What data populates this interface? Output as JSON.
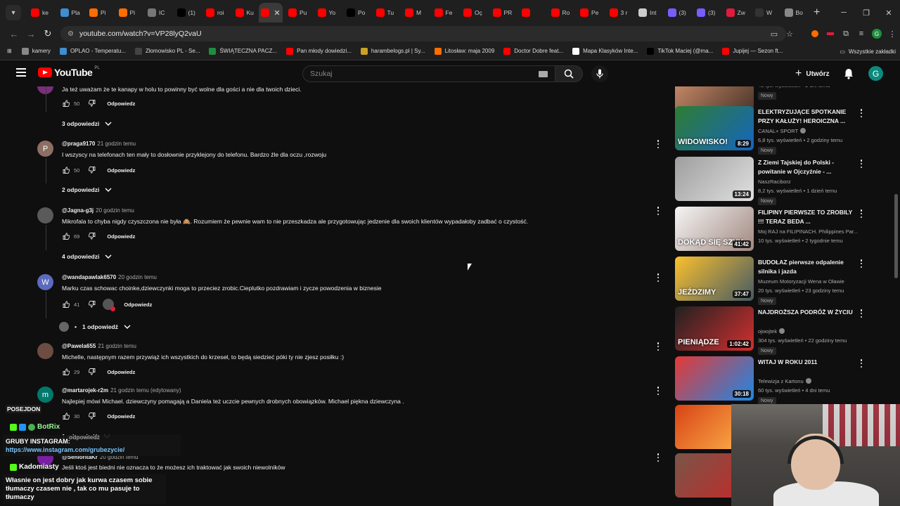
{
  "browser": {
    "tabs": [
      {
        "t": "ke",
        "c": "#ff0000"
      },
      {
        "t": "Pla",
        "c": "#3e8ed0"
      },
      {
        "t": "Pi",
        "c": "#ff6d00"
      },
      {
        "t": "Pi",
        "c": "#ff6d00"
      },
      {
        "t": "IC",
        "c": "#777777"
      },
      {
        "t": "(1)",
        "c": "#000000"
      },
      {
        "t": "roi",
        "c": "#ff0000"
      },
      {
        "t": "Ku",
        "c": "#ff0000"
      },
      {
        "t": "",
        "c": "#ff0000",
        "active": true
      },
      {
        "t": "Pu",
        "c": "#ff0000"
      },
      {
        "t": "Yo",
        "c": "#ff0000"
      },
      {
        "t": "Po",
        "c": "#000000"
      },
      {
        "t": "Tu",
        "c": "#ff0000"
      },
      {
        "t": "M",
        "c": "#ff0000"
      },
      {
        "t": "Fe",
        "c": "#ff0000"
      },
      {
        "t": "Oç",
        "c": "#ff0000"
      },
      {
        "t": "PR",
        "c": "#ff0000"
      },
      {
        "t": "",
        "c": "#ff0000"
      },
      {
        "t": "Ro",
        "c": "#ff0000"
      },
      {
        "t": "Pe",
        "c": "#ff0000"
      },
      {
        "t": "3 r",
        "c": "#ff0000"
      },
      {
        "t": "Int",
        "c": "#cccccc"
      },
      {
        "t": "(3)",
        "c": "#7b5cff"
      },
      {
        "t": "(3)",
        "c": "#7b5cff"
      },
      {
        "t": "Zw",
        "c": "#e21b3c"
      },
      {
        "t": "W",
        "c": "#333333"
      },
      {
        "t": "Bo",
        "c": "#888888"
      }
    ],
    "url": "youtube.com/watch?v=VP28lyQ2vaU",
    "bookmarks": [
      {
        "label": "kamery",
        "c": "#888888"
      },
      {
        "label": "OPLAO - Temperatu...",
        "c": "#3e8ed0"
      },
      {
        "label": "Złomowisko PL - Se...",
        "c": "#444444"
      },
      {
        "label": "ŚWIĄTECZNA PACZ...",
        "c": "#1e8e3e"
      },
      {
        "label": "Pan młody dowiedzi...",
        "c": "#ff0000"
      },
      {
        "label": "harambelogs.pl | Sy...",
        "c": "#c9a227"
      },
      {
        "label": "Litosław: maja 2009",
        "c": "#ff6d00"
      },
      {
        "label": "Doctor Dobre feat...",
        "c": "#ff0000"
      },
      {
        "label": "Mapa Klasyków Inte...",
        "c": "#ffffff"
      },
      {
        "label": "TikTok Maciej (@ma...",
        "c": "#000000"
      },
      {
        "label": "Jupijej — Sezon ft...",
        "c": "#ff0000"
      }
    ],
    "bookmarks_right": "Wszystkie zakładki"
  },
  "youtube": {
    "logo": "YouTube",
    "country": "PL",
    "search_placeholder": "Szukaj",
    "create_label": "Utwórz",
    "avatar_letter": "G"
  },
  "comments": [
    {
      "type": "partial",
      "text": "Ja też uważam że te kanapy w holu to powinny być wolne dla  gości  a nie dla twoich dzieci.",
      "likes": "50",
      "reply": "Odpowiedz",
      "replies": "3 odpowiedzi",
      "av_c": "#7a2f7a"
    },
    {
      "author": "@praga9170",
      "time": "21 godzin temu",
      "text": "I  wszyscy  na  telefonach  ten  mały  to  dosłownie  przyklejony do  telefonu. Bardzo  źle  dla  oczu  ,rozwoju",
      "likes": "50",
      "reply": "Odpowiedz",
      "replies": "2 odpowiedzi",
      "letter": "P",
      "av_c": "#8d6e63"
    },
    {
      "author": "@Jagna-g3j",
      "time": "20 godzin temu",
      "text": "Mikrofala to chyba nigdy czyszczona nie była 🙈. Rozumiem że pewnie wam to nie przeszkadza ale przygotowując jedzenie dla swoich klientów wypadałoby zadbać o czystość.",
      "likes": "69",
      "reply": "Odpowiedz",
      "replies": "4 odpowiedzi",
      "letter": "",
      "av_c": "#5a5a5a"
    },
    {
      "author": "@wandapawlak6570",
      "time": "20 godzin temu",
      "text": "Marku czas schowac choinke,dziewczynki moga to przeciez zrobic.Cieplutko pozdrawiam i zycze powodzenia w biznesie",
      "likes": "41",
      "reply": "Odpowiedz",
      "replies": "1 odpowiedź",
      "letter": "W",
      "av_c": "#5c6bc0"
    },
    {
      "author": "@Pawela655",
      "time": "21 godzin temu",
      "text": "Michelle, następnym razem przywiąż ich wszystkich do krzeseł, to będą siedzieć póki ty nie zjesz posiłku  :)",
      "likes": "29",
      "reply": "Odpowiedz",
      "letter": "",
      "av_c": "#6d4c41"
    },
    {
      "author": "@martarojek-r2m",
      "time": "21 godzin temu (edytowany)",
      "text": "Najlepiej mówi Michael. dziewczyny pomagają  a Daniela też uczcie pewnych drobnych obowiązków. Michael piękna dziewczyna .",
      "likes": "30",
      "reply": "Odpowiedz",
      "replies": "1 odpowiedź",
      "letter": "m",
      "av_c": "#00796b"
    },
    {
      "author": "@SenioritaKr",
      "time": "20 godzin temu",
      "text": "Jeśli ktoś jest biedni nie oznacza to że  możesz ich traktować jak swoich niewolników",
      "letter": "",
      "av_c": "#7b1fa2"
    }
  ],
  "sidebar": [
    {
      "title": "",
      "chan": "",
      "views": "43 tys. wyświetleń",
      "age": "2 dni temu",
      "dur": "26:34",
      "new": "Nowy",
      "thumb": [
        "#c98a6a",
        "#3a2a20"
      ],
      "overlay": ""
    },
    {
      "title": "ELEKTRYZUJĄCE SPOTKANIE PRZY KAŁUŻY! HEROICZNA ...",
      "chan": "CANAL+ SPORT",
      "verified": true,
      "views": "6,8 tys. wyświetleń",
      "age": "2 godziny temu",
      "dur": "8:29",
      "new": "Nowy",
      "thumb": [
        "#2e7d32",
        "#1565c0"
      ],
      "overlay": "WIDOWISKO!"
    },
    {
      "title": "Z Ziemi Tajskiej do Polski - powitanie w Ojczyźnie - ...",
      "chan": "NaszRaciborz",
      "views": "8,2 tys. wyświetleń",
      "age": "1 dzień temu",
      "dur": "13:24",
      "new": "Nowy",
      "thumb": [
        "#9e9e9e",
        "#e0e0e0"
      ],
      "overlay": ""
    },
    {
      "title": "FILIPINY  PIERWSZE TO ZROBILY !!! TERAZ BEDA ...",
      "chan": "Moj RAJ na FILIPINACH. Philippines Par...",
      "views": "10 tys. wyświetleń",
      "age": "2 tygodnie temu",
      "dur": "41:42",
      "new": "",
      "thumb": [
        "#f5f5f5",
        "#a1887f"
      ],
      "overlay": "DOKĄD SIĘ SZYK"
    },
    {
      "title": "BUDOŁAZ pierwsze odpalenie silnika i jazda",
      "chan": "Muzeum Motoryzacji Wena w Oławie",
      "views": "20 tys. wyświetleń",
      "age": "23 godziny temu",
      "dur": "37:47",
      "new": "Nowy",
      "thumb": [
        "#fbc02d",
        "#455a64"
      ],
      "overlay": "JEŹDZIMY"
    },
    {
      "title": "NAJDROŻSZA PODRÓŻ W ŻYCIU",
      "chan": "ojwojtek",
      "verified": true,
      "views": "304 tys. wyświetleń",
      "age": "22 godziny temu",
      "dur": "1:02:42",
      "new": "Nowy",
      "thumb": [
        "#212121",
        "#d32f2f"
      ],
      "overlay": "PIENIĄDZE"
    },
    {
      "title": "WITAJ W ROKU 2011",
      "chan": "Telewizja z Kartonu",
      "verified": true,
      "views": "60 tys. wyświetleń",
      "age": "4 dni temu",
      "dur": "30:18",
      "new": "Nowy",
      "thumb": [
        "#e53935",
        "#1e88e5"
      ],
      "overlay": ""
    },
    {
      "title": "",
      "chan": "",
      "views": "",
      "age": "",
      "dur": "",
      "new": "",
      "thumb": [
        "#d84315",
        "#ffb74d"
      ],
      "overlay": ""
    },
    {
      "title": "",
      "chan": "",
      "views": "",
      "age": "",
      "dur": "",
      "new": "",
      "thumb": [
        "#795548",
        "#c62828"
      ],
      "overlay": ""
    }
  ],
  "overlay": {
    "top_label": "POSEJDON",
    "bot_name": "BotRix",
    "instagram_label": "GRUBY INSTAGRAM:",
    "instagram_link": "https://www.instagram.com/grubezycie/",
    "hidden_reply": "odpowiedź",
    "user2": "Kadomiasty",
    "msg2": "Własnie on jest dobry jak kurwa czasem sobie tłumaczy czasem nie , tak co mu pasuje to tłumaczy"
  }
}
